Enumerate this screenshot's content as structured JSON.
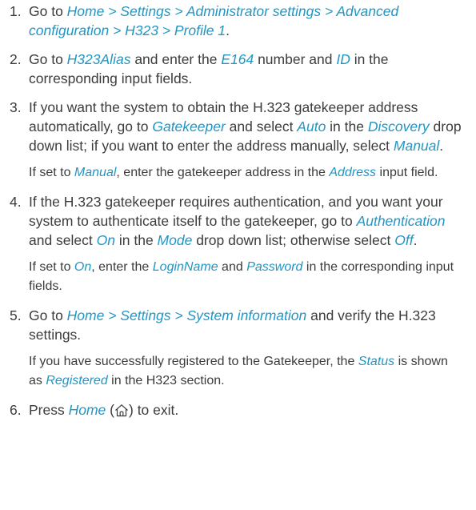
{
  "steps": [
    {
      "num": "1.",
      "p1": [
        {
          "t": "Go to "
        },
        {
          "t": "Home > Settings > Administrator settings > Advanced configuration > H323 > Profile 1",
          "hl": true
        },
        {
          "t": "."
        }
      ]
    },
    {
      "num": "2.",
      "p1": [
        {
          "t": "Go to "
        },
        {
          "t": "H323Alias",
          "hl": true
        },
        {
          "t": " and enter the "
        },
        {
          "t": "E164",
          "hl": true
        },
        {
          "t": " number and "
        },
        {
          "t": "ID",
          "hl": true
        },
        {
          "t": " in the corresponding input fields."
        }
      ]
    },
    {
      "num": "3.",
      "p1": [
        {
          "t": "If you want the system to obtain the H.323 gatekeeper address automatically, go to "
        },
        {
          "t": "Gatekeeper",
          "hl": true
        },
        {
          "t": " and select "
        },
        {
          "t": "Auto",
          "hl": true
        },
        {
          "t": " in the "
        },
        {
          "t": "Discovery",
          "hl": true
        },
        {
          "t": " drop down list; if you want to enter the address manually, select "
        },
        {
          "t": "Manual",
          "hl": true
        },
        {
          "t": "."
        }
      ],
      "p2": [
        {
          "t": "If set to "
        },
        {
          "t": "Manual",
          "hl": true
        },
        {
          "t": ", enter the gatekeeper address in the "
        },
        {
          "t": "Address",
          "hl": true
        },
        {
          "t": " input field."
        }
      ]
    },
    {
      "num": "4.",
      "p1": [
        {
          "t": "If the H.323 gatekeeper requires authentication, and you want your system to authenticate itself to the gatekeeper, go to "
        },
        {
          "t": "Authentication",
          "hl": true
        },
        {
          "t": " and select "
        },
        {
          "t": "On",
          "hl": true
        },
        {
          "t": " in the "
        },
        {
          "t": "Mode",
          "hl": true
        },
        {
          "t": " drop down list; otherwise select "
        },
        {
          "t": "Off",
          "hl": true
        },
        {
          "t": "."
        }
      ],
      "p2": [
        {
          "t": "If set to "
        },
        {
          "t": "On",
          "hl": true
        },
        {
          "t": ", enter the "
        },
        {
          "t": "LoginName",
          "hl": true
        },
        {
          "t": " and "
        },
        {
          "t": "Password",
          "hl": true
        },
        {
          "t": " in the corresponding input fields."
        }
      ]
    },
    {
      "num": "5.",
      "p1": [
        {
          "t": "Go to "
        },
        {
          "t": "Home > Settings > System information",
          "hl": true
        },
        {
          "t": " and verify the H.323 settings."
        }
      ],
      "p2": [
        {
          "t": "If you have successfully registered to the Gatekeeper, the "
        },
        {
          "t": "Status",
          "hl": true
        },
        {
          "t": " is shown as "
        },
        {
          "t": "Registered",
          "hl": true
        },
        {
          "t": " in the H323 section."
        }
      ]
    },
    {
      "num": "6.",
      "p1": [
        {
          "t": "Press "
        },
        {
          "t": "Home",
          "hl": true
        },
        {
          "t": " ("
        },
        {
          "icon": "home-icon"
        },
        {
          "t": ") to exit."
        }
      ]
    }
  ],
  "colors": {
    "text": "#3c3c3c",
    "link": "#2196c4"
  }
}
